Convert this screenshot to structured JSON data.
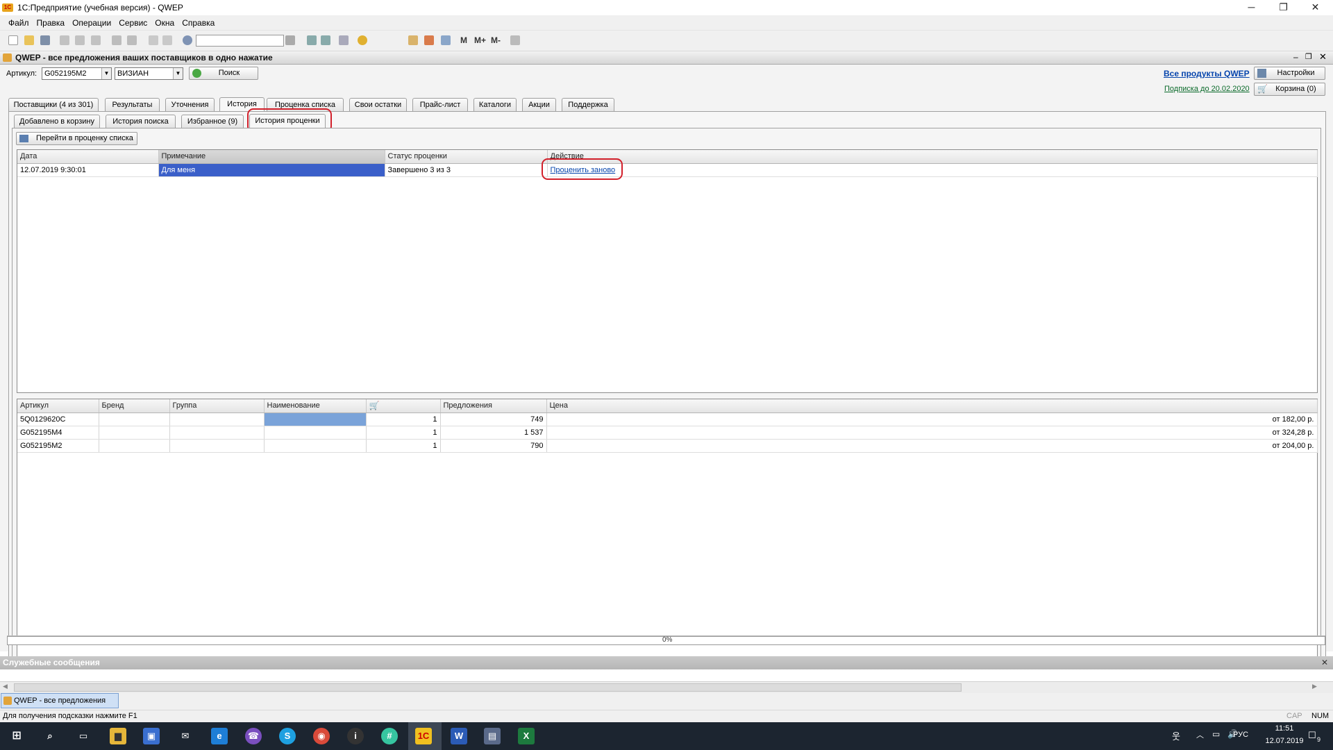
{
  "window": {
    "title": "1С:Предприятие (учебная версия) - QWEP",
    "logo_text": "1С",
    "minimize": "─",
    "restore": "❐",
    "close": "✕"
  },
  "menu": [
    "Файл",
    "Правка",
    "Операции",
    "Сервис",
    "Окна",
    "Справка"
  ],
  "toolbar": {
    "m": "M",
    "mplus": "M+",
    "mminus": "M-"
  },
  "document": {
    "title": "QWEP - все предложения ваших поставщиков в одно нажатие"
  },
  "search": {
    "article_label": "Артикул:",
    "article_value": "G052195M2",
    "brand_value": "ВИЗИАН",
    "search_button": "Поиск"
  },
  "header_links": {
    "all_products": "Все продукты QWEP",
    "settings": "Настройки",
    "subscription": "Подписка до 20.02.2020",
    "cart": "Корзина (0)"
  },
  "tabs": [
    "Поставщики (4 из 301)",
    "Результаты",
    "Уточнения",
    "История",
    "Проценка списка",
    "Свои остатки",
    "Прайс-лист",
    "Каталоги",
    "Акции",
    "Поддержка"
  ],
  "subtabs": [
    "Добавлено в корзину",
    "История поиска",
    "Избранное (9)",
    "История проценки"
  ],
  "goto_button": "Перейти в проценку списка",
  "history_table": {
    "columns": [
      "Дата",
      "Примечание",
      "Статус проценки",
      "Действие"
    ],
    "rows": [
      {
        "date": "12.07.2019 9:30:01",
        "note": "Для меня",
        "status": "Завершено 3 из 3",
        "action": "Проценить заново"
      }
    ]
  },
  "items_table": {
    "columns": [
      "Артикул",
      "Бренд",
      "Группа",
      "Наименование",
      "",
      "Предложения",
      "Цена"
    ],
    "rows": [
      {
        "article": "5Q0129620C",
        "brand": "",
        "group": "",
        "name": "",
        "qty": "1",
        "offers": "749",
        "price": "от 182,00 р."
      },
      {
        "article": "G052195M4",
        "brand": "",
        "group": "",
        "name": "",
        "qty": "1",
        "offers": "1 537",
        "price": "от 324,28 р."
      },
      {
        "article": "G052195M2",
        "brand": "",
        "group": "",
        "name": "",
        "qty": "1",
        "offers": "790",
        "price": "от 204,00 р."
      }
    ]
  },
  "progress": {
    "text": "0%",
    "value": 0
  },
  "messages": {
    "title": "Служебные сообщения"
  },
  "window_tab": "QWEP - все предложения в...",
  "status": {
    "hint": "Для получения подсказки нажмите F1",
    "cap": "CAP",
    "num": "NUM"
  },
  "taskbar": {
    "lang": "РУС",
    "time": "11:51",
    "date": "12.07.2019",
    "notif": "9"
  }
}
